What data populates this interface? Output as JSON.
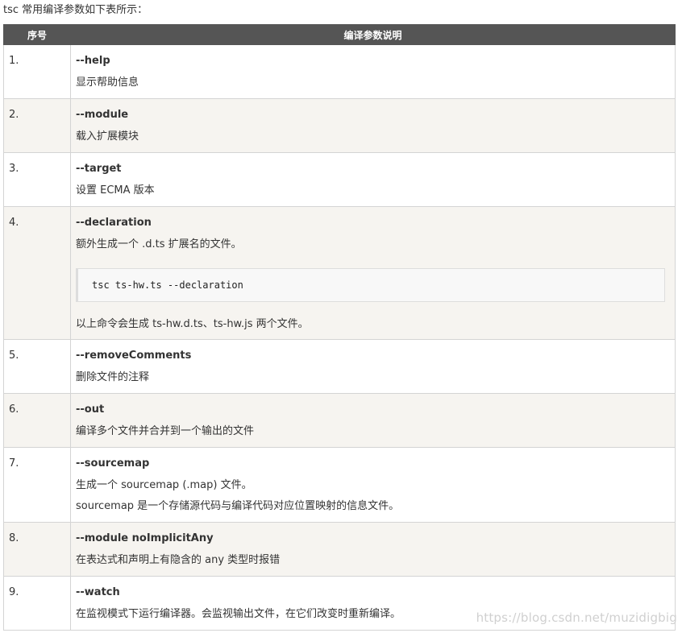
{
  "intro": "tsc 常用编译参数如下表所示：",
  "table": {
    "headers": [
      "序号",
      "编译参数说明"
    ],
    "rows": [
      {
        "num": "1.",
        "option": "--help",
        "lines": [
          "显示帮助信息"
        ]
      },
      {
        "num": "2.",
        "option": "--module",
        "lines": [
          "载入扩展模块"
        ]
      },
      {
        "num": "3.",
        "option": "--target",
        "lines": [
          "设置 ECMA 版本"
        ]
      },
      {
        "num": "4.",
        "option": "--declaration",
        "lines": [
          "额外生成一个 .d.ts 扩展名的文件。"
        ],
        "code": "tsc ts-hw.ts --declaration",
        "after": "以上命令会生成 ts-hw.d.ts、ts-hw.js 两个文件。"
      },
      {
        "num": "5.",
        "option": "--removeComments",
        "lines": [
          "删除文件的注释"
        ]
      },
      {
        "num": "6.",
        "option": "--out",
        "lines": [
          "编译多个文件并合并到一个输出的文件"
        ]
      },
      {
        "num": "7.",
        "option": "--sourcemap",
        "lines": [
          "生成一个 sourcemap (.map) 文件。",
          "sourcemap 是一个存储源代码与编译代码对应位置映射的信息文件。"
        ]
      },
      {
        "num": "8.",
        "option": "--module noImplicitAny",
        "lines": [
          "在表达式和声明上有隐含的 any 类型时报错"
        ]
      },
      {
        "num": "9.",
        "option": "--watch",
        "lines": [
          "在监视模式下运行编译器。会监视输出文件，在它们改变时重新编译。"
        ]
      }
    ]
  },
  "watermark": "https://blog.csdn.net/muzidigbig"
}
